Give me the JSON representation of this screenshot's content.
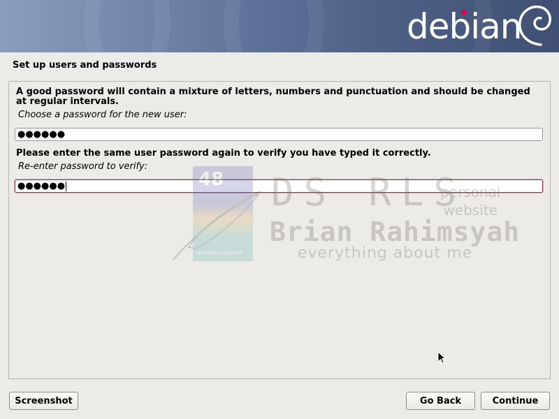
{
  "header": {
    "brand": "debian"
  },
  "page": {
    "title": "Set up users and passwords"
  },
  "form": {
    "description": "A good password will contain a mixture of letters, numbers and punctuation and should be changed at regular intervals.",
    "password_label": "Choose a password for the new user:",
    "password_value": "●●●●●●",
    "verify_description": "Please enter the same user password again to verify you have typed it correctly.",
    "verify_label": "Re-enter password to verify:",
    "verify_value": "●●●●●●"
  },
  "watermark": {
    "badge_number": "48",
    "badge_caption": "open|source|lovers",
    "initials": "DS RLS",
    "name": "Brian Rahimsyah",
    "tagline": "everything about me",
    "personal_line1": "personal",
    "personal_line2": "website"
  },
  "buttons": {
    "screenshot": "Screenshot",
    "go_back": "Go Back",
    "continue": "Continue"
  },
  "icons": {
    "logo": "debian-swirl-icon",
    "cursor": "mouse-pointer-icon"
  },
  "colors": {
    "brand_accent": "#d70751",
    "focus_border": "#a0305a"
  }
}
